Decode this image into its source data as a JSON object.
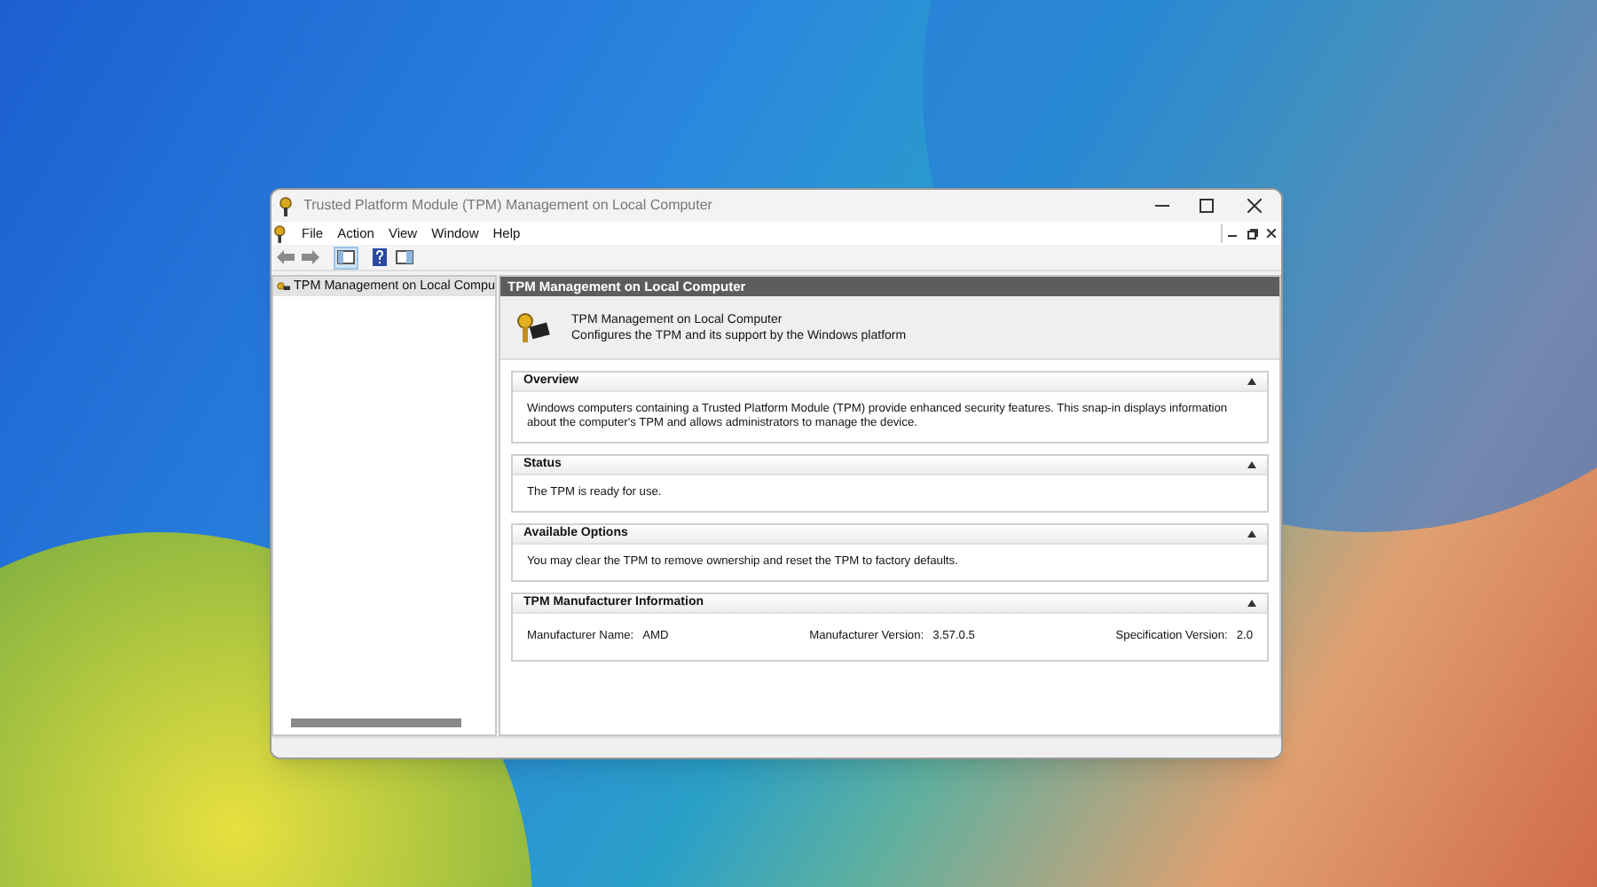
{
  "window": {
    "title": "Trusted Platform Module (TPM) Management on Local Computer"
  },
  "menu": [
    "File",
    "Action",
    "View",
    "Window",
    "Help"
  ],
  "tree": {
    "items": [
      {
        "label": "TPM Management on Local Compu",
        "selected": true
      }
    ]
  },
  "content": {
    "header": "TPM Management on Local Computer",
    "summary": {
      "title": "TPM Management on Local Computer",
      "description": "Configures the TPM and its support by the Windows platform"
    },
    "sections": [
      {
        "title": "Overview",
        "kind": "text",
        "text": "Windows computers containing a Trusted Platform Module (TPM) provide enhanced security features. This snap-in displays information about the computer's TPM and allows administrators to manage the device."
      },
      {
        "title": "Status",
        "kind": "text",
        "text": "The TPM is ready for use."
      },
      {
        "title": "Available Options",
        "kind": "text",
        "text": "You may clear the TPM to remove ownership and reset the TPM to factory defaults."
      },
      {
        "title": "TPM Manufacturer Information",
        "kind": "fields",
        "fields": [
          {
            "label": "Manufacturer Name:",
            "value": "AMD"
          },
          {
            "label": "Manufacturer Version:",
            "value": "3.57.0.5"
          },
          {
            "label": "Specification Version:",
            "value": "2.0"
          }
        ]
      }
    ]
  }
}
